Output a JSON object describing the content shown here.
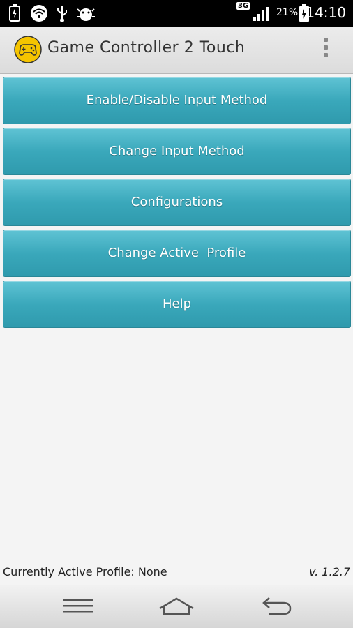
{
  "status_bar": {
    "network_label": "3G",
    "battery_percent": "21%",
    "time": "14:10",
    "icons": [
      "usb-battery-icon",
      "wifi-icon",
      "usb-icon",
      "android-debug-icon",
      "signal-icon",
      "battery-icon"
    ]
  },
  "action_bar": {
    "title": "Game Controller 2 Touch",
    "app_icon": "gamepad-icon",
    "overflow_icon": "overflow-menu-icon"
  },
  "menu": {
    "items": [
      {
        "label": "Enable/Disable Input Method"
      },
      {
        "label": "Change Input Method"
      },
      {
        "label": "Configurations"
      },
      {
        "label": "Change Active  Profile"
      },
      {
        "label": "Help"
      }
    ]
  },
  "footer": {
    "active_profile": "Currently Active Profile: None",
    "version": "v. 1.2.7"
  },
  "nav_bar": {
    "icons": [
      "menu-icon",
      "home-icon",
      "back-icon"
    ]
  },
  "colors": {
    "button_top": "#5fc3d4",
    "button_bottom": "#2f9aad",
    "app_icon_yellow": "#f5c400"
  }
}
